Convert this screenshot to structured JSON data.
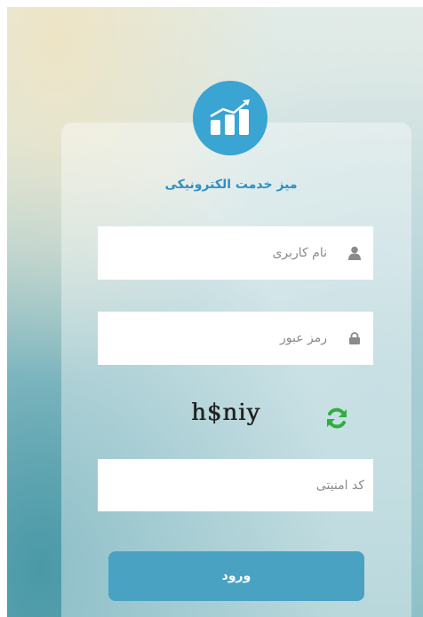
{
  "app": {
    "title": "میز خدمت الکترونیکی",
    "logo_icon": "growth-chart-icon"
  },
  "form": {
    "username": {
      "placeholder": "نام کاربری",
      "value": "",
      "icon": "user-icon"
    },
    "password": {
      "placeholder": "رمز عبور",
      "value": "",
      "icon": "lock-icon"
    },
    "captcha": {
      "image_text": "h$niy",
      "refresh_icon": "refresh-icon",
      "placeholder": "کد امنیتی",
      "value": ""
    },
    "submit_label": "ورود"
  },
  "colors": {
    "accent": "#3aa4d2",
    "title": "#2f8fc2",
    "button": "#4aa2c3",
    "refresh": "#2fae3e"
  }
}
